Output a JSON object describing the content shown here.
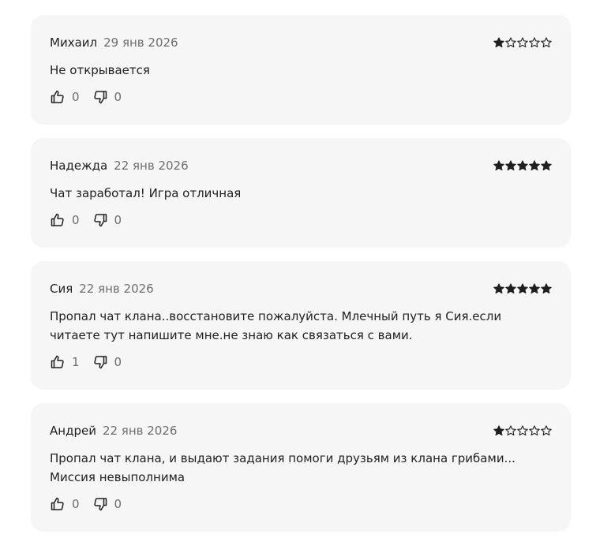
{
  "reviews": [
    {
      "author": "Михаил",
      "date": "29 янв 2026",
      "rating": 1,
      "text": "Не открывается",
      "likes": "0",
      "dislikes": "0"
    },
    {
      "author": "Надежда",
      "date": "22 янв 2026",
      "rating": 5,
      "text": "Чат заработал! Игра отличная",
      "likes": "0",
      "dislikes": "0"
    },
    {
      "author": "Сия",
      "date": "22 янв 2026",
      "rating": 5,
      "text": "Пропал чат клана..восстановите пожалуйста. Млечный путь я Сия.если читаете тут напишите мне.не знаю как связаться с вами.",
      "likes": "1",
      "dislikes": "0"
    },
    {
      "author": "Андрей",
      "date": "22 янв 2026",
      "rating": 1,
      "text": "Пропал чат клана, и выдают задания помоги друзьям из клана грибами... Миссия невыполнима",
      "likes": "0",
      "dislikes": "0"
    }
  ],
  "colors": {
    "card_background": "#f6f6f6",
    "text": "#1f1f1f",
    "muted": "#6d6d6d",
    "star": "#1f1f1f"
  },
  "icons": {
    "like": "thumbs-up-icon",
    "dislike": "thumbs-down-icon",
    "star_filled": "star-filled-icon",
    "star_empty": "star-outline-icon"
  }
}
